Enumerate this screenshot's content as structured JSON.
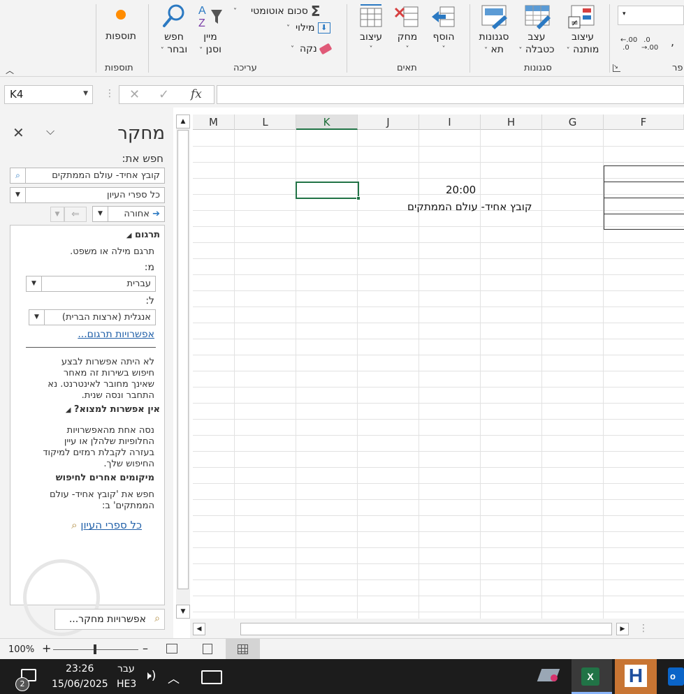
{
  "ribbon": {
    "addins": {
      "button": "תוספות",
      "group": "תוספות"
    },
    "editing": {
      "group": "עריכה",
      "find_select": [
        "חפש",
        "ובחר"
      ],
      "sort_filter": [
        "מיין",
        "וסנן"
      ],
      "autosum": "סכום אוטומטי",
      "fill": "מילוי",
      "clear": "נקה"
    },
    "cells": {
      "group": "תאים",
      "format": "עיצוב",
      "delete": "מחק",
      "insert": "הוסף"
    },
    "styles": {
      "group": "סגנונות",
      "cell_styles": [
        "סגנונות",
        "תא"
      ],
      "format_as_table": [
        "עצב",
        "כטבלה"
      ],
      "conditional": [
        "עיצוב",
        "מותנה"
      ]
    },
    "number": {
      "group_partial": "פר",
      "dec_inc": ".00\n.0",
      "dec_dec": ".0\n.00"
    }
  },
  "formula_bar": {
    "name_box": "K4",
    "fx": "fx",
    "formula": ""
  },
  "research_pane": {
    "title": "מחקר",
    "search_for_label": "חפש את:",
    "search_value": "קובץ אחיד- עולם הממתקים",
    "source": "כל ספרי העיון",
    "back": "אחורה",
    "translate": {
      "heading": "תרגום",
      "desc": "תרגם מילה או משפט.",
      "from_label": "מ:",
      "from_value": "עברית",
      "to_label": "ל:",
      "to_value": "אנגלית (ארצות הברית)",
      "options_link": "אפשרויות תרגום..."
    },
    "error_lines": [
      "לא היתה אפשרות לבצע",
      "חיפוש בשירות זה מאחר",
      "שאינך מחובר לאינטרנט. נא",
      "התחבר ונסה שנית."
    ],
    "not_found": {
      "heading": "אין אפשרות למצוא?",
      "lines": [
        "נסה אחת מהאפשרויות",
        "החלופיות שלהלן או עיין",
        "בעזרה לקבלת רמזים למיקוד",
        "החיפוש שלך."
      ]
    },
    "other_places": {
      "heading": "מיקומים אחרים לחיפוש",
      "lines": [
        "חפש את 'קובץ אחיד- עולם",
        "הממתקים' ב:"
      ],
      "link": "כל ספרי העיון"
    },
    "research_options": "אפשרויות מחקר..."
  },
  "grid": {
    "columns": [
      "M",
      "L",
      "K",
      "J",
      "I",
      "H",
      "G",
      "F"
    ],
    "selected_column": "K",
    "cells": {
      "time": "20:00",
      "title": "קובץ אחיד- עולם הממתקים"
    }
  },
  "status": {
    "zoom": "100%",
    "plus": "+",
    "minus": "–"
  },
  "taskbar": {
    "time": "23:26",
    "date": "15/06/2025",
    "lang": "עבר",
    "lang_code": "HE3",
    "notifications": "2"
  },
  "colors": {
    "excel_green": "#217346",
    "accent_orange": "#ff8c00",
    "link_blue": "#1f5fa8"
  }
}
